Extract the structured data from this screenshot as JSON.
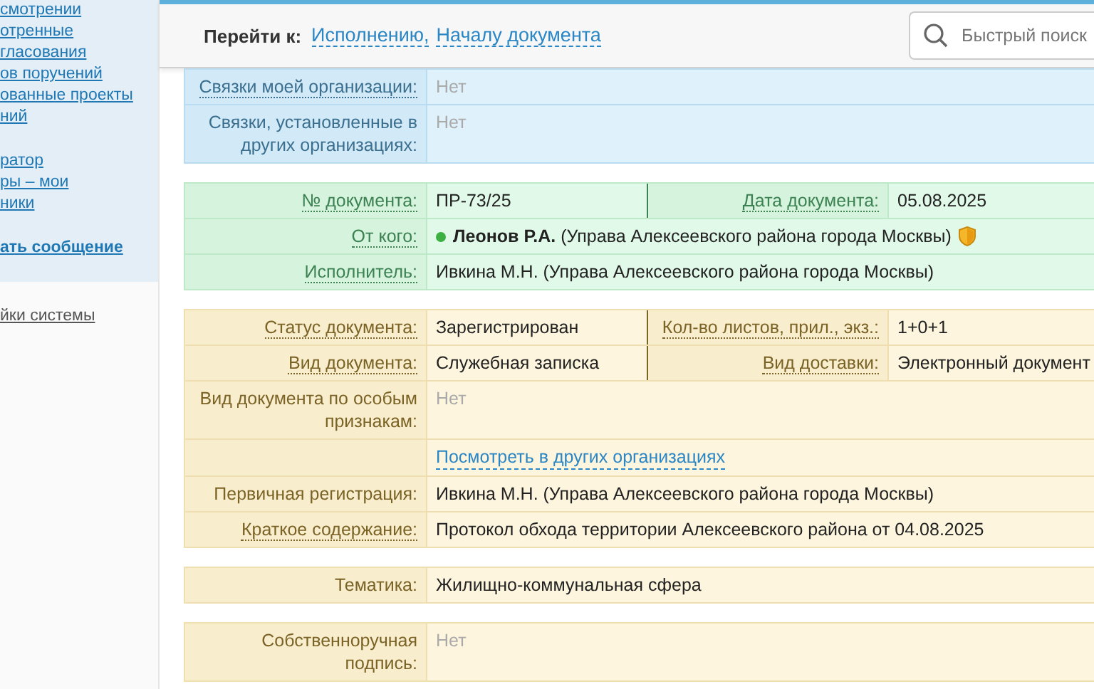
{
  "sidebar": {
    "groups": [
      {
        "items": [
          {
            "label": "смотрении",
            "kind": "link"
          },
          {
            "label": "отренные",
            "kind": "link"
          },
          {
            "label": "гласования",
            "kind": "link"
          },
          {
            "label": "ов поручений",
            "kind": "link"
          },
          {
            "label": "ованные проекты",
            "kind": "link"
          },
          {
            "label": "ний",
            "kind": "link"
          }
        ]
      },
      {
        "items": [
          {
            "label": "ратор",
            "kind": "link"
          },
          {
            "label": "ры – мои",
            "kind": "link"
          },
          {
            "label": "ники",
            "kind": "link"
          }
        ]
      },
      {
        "items": [
          {
            "label": "ать сообщение",
            "kind": "action"
          }
        ]
      }
    ],
    "footer_link": "йки системы"
  },
  "header": {
    "goto_label": "Перейти к:",
    "links": [
      "Исполнению,",
      "Началу документа"
    ],
    "search": {
      "placeholder": "Быстрый поиск"
    }
  },
  "sections": [
    {
      "kind": "links",
      "rows": [
        {
          "cells": [
            {
              "label": "Связки моей организации:",
              "label_link": true,
              "value": {
                "kind": "none",
                "text": "Нет"
              }
            }
          ]
        },
        {
          "cells": [
            {
              "label": "Связки, установленные в других организациях:",
              "label_link": false,
              "value": {
                "kind": "none",
                "text": "Нет"
              }
            }
          ]
        }
      ]
    },
    {
      "kind": "origin",
      "rows": [
        {
          "cells": [
            {
              "label": "№ документа:",
              "label_link": true,
              "value": {
                "kind": "text",
                "text": "ПР-73/25"
              }
            },
            {
              "label": "Дата документа:",
              "label_link": true,
              "value": {
                "kind": "text",
                "text": "05.08.2025"
              }
            }
          ]
        },
        {
          "cells": [
            {
              "label": "От кого:",
              "label_link": true,
              "value": {
                "kind": "person",
                "text": "**Леонов Р.А.** (Управа Алексеевского района города Москвы)",
                "online": true
              }
            }
          ]
        },
        {
          "cells": [
            {
              "label": "Исполнитель:",
              "label_link": true,
              "value": {
                "kind": "text",
                "text": "Ивкина М.Н. (Управа Алексеевского района города Москвы)"
              }
            }
          ]
        }
      ]
    },
    {
      "kind": "details",
      "rows": [
        {
          "cells": [
            {
              "label": "Статус документа:",
              "label_link": true,
              "value": {
                "kind": "text",
                "text": "Зарегистрирован"
              }
            },
            {
              "label": "Кол-во листов, прил., экз.:",
              "label_link": true,
              "value": {
                "kind": "text",
                "text": "1+0+1"
              }
            }
          ]
        },
        {
          "cells": [
            {
              "label": "Вид документа:",
              "label_link": true,
              "value": {
                "kind": "text",
                "text": "Служебная записка"
              }
            },
            {
              "label": "Вид доставки:",
              "label_link": true,
              "value": {
                "kind": "text",
                "text": "Электронный документ"
              }
            }
          ]
        },
        {
          "cells": [
            {
              "label": "Вид документа по особым признакам:",
              "label_link": false,
              "value": {
                "kind": "none",
                "text": "Нет"
              }
            }
          ]
        },
        {
          "cells": [
            {
              "value": {
                "kind": "link",
                "text": "Посмотреть в других организациях"
              }
            }
          ]
        },
        {
          "cells": [
            {
              "label": "Первичная регистрация:",
              "label_link": false,
              "value": {
                "kind": "text",
                "text": "Ивкина М.Н. (Управа Алексеевского района города Москвы)"
              }
            }
          ]
        },
        {
          "cells": [
            {
              "label": "Краткое содержание:",
              "label_link": true,
              "value": {
                "kind": "text",
                "text": "Протокол обхода территории Алексеевского района от 04.08.2025"
              }
            }
          ]
        }
      ]
    },
    {
      "kind": "details",
      "rows": [
        {
          "cells": [
            {
              "label": "Тематика:",
              "label_link": false,
              "value": {
                "kind": "text",
                "text": "Жилищно-коммунальная сфера"
              }
            }
          ]
        }
      ]
    },
    {
      "kind": "details",
      "rows": [
        {
          "cells": [
            {
              "label": "Собственноручная подпись:",
              "label_link": false,
              "value": {
                "kind": "none",
                "text": "Нет"
              }
            }
          ]
        }
      ]
    }
  ]
}
